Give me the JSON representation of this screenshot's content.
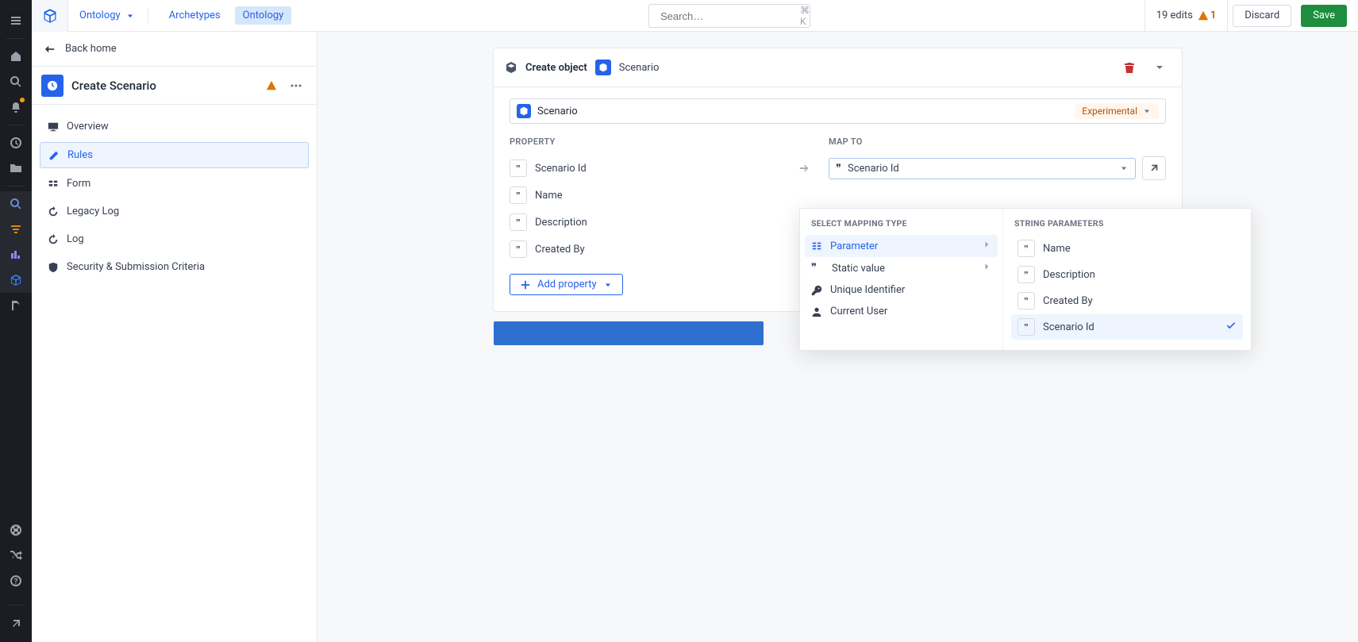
{
  "topbar": {
    "breadcrumb_root": "Ontology",
    "tabs": [
      "Archetypes",
      "Ontology"
    ],
    "active_tab_index": 1,
    "search_placeholder": "Search…",
    "search_shortcut": "⌘ K",
    "edits_text": "19 edits",
    "warn_count": "1",
    "discard_label": "Discard",
    "save_label": "Save"
  },
  "leftpanel": {
    "back_label": "Back home",
    "title": "Create Scenario",
    "nav": [
      {
        "label": "Overview",
        "icon": "monitor-icon"
      },
      {
        "label": "Rules",
        "icon": "pencil-icon",
        "active": true
      },
      {
        "label": "Form",
        "icon": "form-icon"
      },
      {
        "label": "Legacy Log",
        "icon": "history-icon"
      },
      {
        "label": "Log",
        "icon": "history-icon"
      },
      {
        "label": "Security & Submission Criteria",
        "icon": "shield-icon"
      }
    ]
  },
  "card": {
    "header_label": "Create object",
    "header_object": "Scenario",
    "scenario_name": "Scenario",
    "badge": "Experimental",
    "col_property": "PROPERTY",
    "col_mapto": "MAP TO",
    "properties": [
      {
        "label": "Scenario Id"
      },
      {
        "label": "Name"
      },
      {
        "label": "Description"
      },
      {
        "label": "Created By"
      }
    ],
    "mapto_first_value": "Scenario Id",
    "add_property": "Add property"
  },
  "popover": {
    "left_head": "SELECT MAPPING TYPE",
    "items": [
      {
        "label": "Parameter",
        "icon": "param-icon",
        "submenu": true,
        "active": true
      },
      {
        "label": "Static value",
        "icon": "quote-icon",
        "submenu": true
      },
      {
        "label": "Unique Identifier",
        "icon": "key-icon"
      },
      {
        "label": "Current User",
        "icon": "user-icon"
      }
    ],
    "right_head": "STRING PARAMETERS",
    "params": [
      {
        "label": "Name"
      },
      {
        "label": "Description"
      },
      {
        "label": "Created By"
      },
      {
        "label": "Scenario Id",
        "selected": true
      }
    ]
  }
}
